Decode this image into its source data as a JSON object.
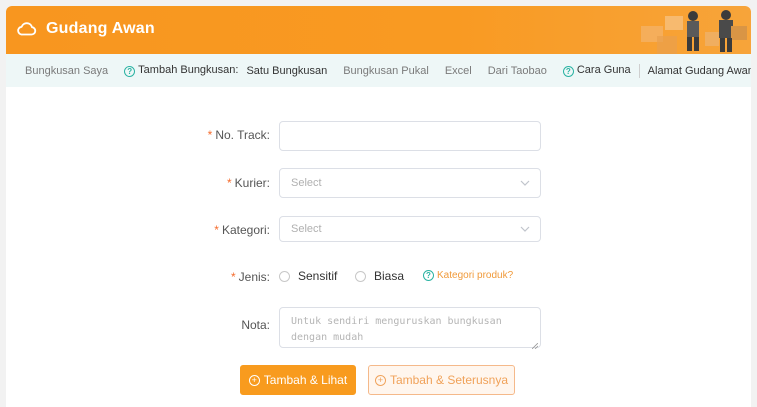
{
  "header": {
    "title": "Gudang Awan",
    "icon": "cloud-icon",
    "accent": "#f8961f"
  },
  "subnav": {
    "left_items": [
      {
        "label": "Bungkusan Saya"
      },
      {
        "label": "Tambah Bungkusan:"
      },
      {
        "label": "Satu Bungkusan"
      },
      {
        "label": "Bungkusan Pukal"
      },
      {
        "label": "Excel"
      },
      {
        "label": "Dari Taobao"
      }
    ],
    "right_items": [
      {
        "label": "Cara Guna"
      },
      {
        "label": "Alamat Gudang Awan"
      }
    ]
  },
  "form": {
    "track": {
      "label": "No. Track:",
      "value": "",
      "placeholder": ""
    },
    "kurier": {
      "label": "Kurier:",
      "placeholder": "Select"
    },
    "kategori": {
      "label": "Kategori:",
      "placeholder": "Select"
    },
    "jenis": {
      "label": "Jenis:",
      "options": [
        "Sensitif",
        "Biasa"
      ],
      "help_link": "Kategori produk?"
    },
    "nota": {
      "label": "Nota:",
      "placeholder": "Untuk sendiri menguruskan bungkusan dengan mudah"
    },
    "required_mark": "*"
  },
  "actions": {
    "primary": "Tambah & Lihat",
    "secondary": "Tambah & Seterusnya"
  }
}
